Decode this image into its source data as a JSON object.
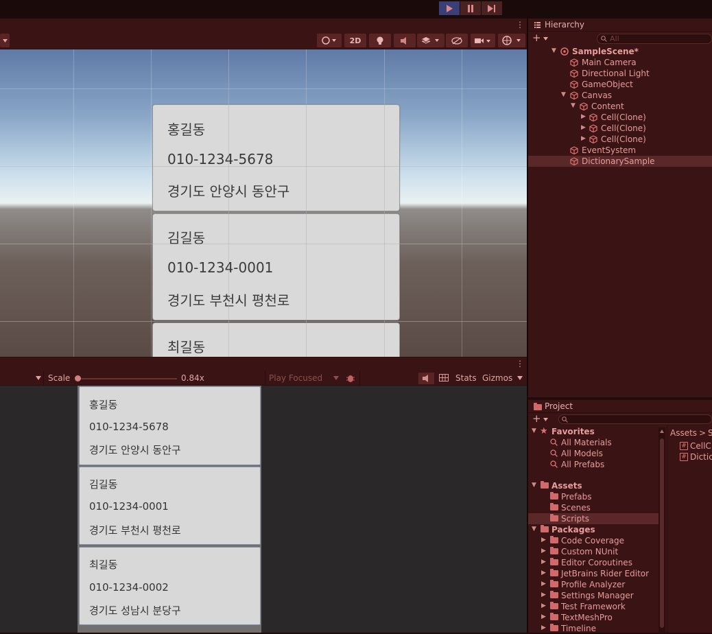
{
  "colors": {
    "accent_text": "#e89c9c",
    "panel_bg": "#3a1414",
    "play_active": "#3a3f78"
  },
  "toolbar": {
    "play_icon": "play-icon",
    "pause_icon": "pause-icon",
    "step_icon": "step-icon"
  },
  "scene_toolbar": {
    "twod_label": "2D"
  },
  "scene_cards": [
    {
      "name": "홍길동",
      "phone": "010-1234-5678",
      "address": "경기도 안양시 동안구"
    },
    {
      "name": "김길동",
      "phone": "010-1234-0001",
      "address": "경기도 부천시 평천로"
    },
    {
      "name": "최길동"
    }
  ],
  "game_toolbar": {
    "scale_label": "Scale",
    "scale_value": "0.84x",
    "scale_fraction": 0.0,
    "play_focused": "Play Focused",
    "stats": "Stats",
    "gizmos": "Gizmos"
  },
  "game_cards": [
    {
      "name": "홍길동",
      "phone": "010-1234-5678",
      "address": "경기도 안양시 동안구"
    },
    {
      "name": "김길동",
      "phone": "010-1234-0001",
      "address": "경기도 부천시 평천로"
    },
    {
      "name": "최길동",
      "phone": "010-1234-0002",
      "address": "경기도 성남시 분당구"
    }
  ],
  "hierarchy": {
    "tab": "Hierarchy",
    "search_placeholder": "All",
    "items": [
      {
        "label": "SampleScene*"
      },
      {
        "label": "Main Camera"
      },
      {
        "label": "Directional Light"
      },
      {
        "label": "GameObject"
      },
      {
        "label": "Canvas"
      },
      {
        "label": "Content"
      },
      {
        "label": "Cell(Clone)"
      },
      {
        "label": "Cell(Clone)"
      },
      {
        "label": "Cell(Clone)"
      },
      {
        "label": "EventSystem"
      },
      {
        "label": "DictionarySample"
      }
    ]
  },
  "project": {
    "tab": "Project",
    "favorites": "Favorites",
    "favorite_items": [
      "All Materials",
      "All Models",
      "All Prefabs"
    ],
    "assets": "Assets",
    "asset_folders": [
      "Prefabs",
      "Scenes",
      "Scripts"
    ],
    "packages": "Packages",
    "package_folders": [
      "Code Coverage",
      "Custom NUnit",
      "Editor Coroutines",
      "JetBrains Rider Editor",
      "Profile Analyzer",
      "Settings Manager",
      "Test Framework",
      "TextMeshPro",
      "Timeline"
    ],
    "breadcrumb_root": "Assets",
    "breadcrumb_sep": ">",
    "breadcrumb_child": "S",
    "files": [
      "CellC",
      "Dictic"
    ]
  }
}
